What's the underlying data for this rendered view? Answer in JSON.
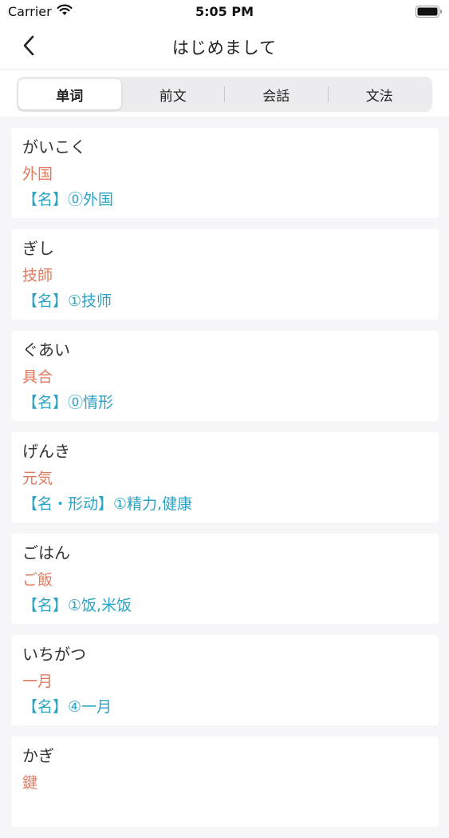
{
  "status_bar": {
    "carrier": "Carrier",
    "time": "5:05 PM"
  },
  "nav": {
    "title": "はじめまして"
  },
  "tabs": [
    {
      "label": "单词",
      "active": true
    },
    {
      "label": "前文",
      "active": false
    },
    {
      "label": "会話",
      "active": false
    },
    {
      "label": "文法",
      "active": false
    }
  ],
  "words": [
    {
      "kana": "がいこく",
      "kanji": "外国",
      "meaning": "【名】⓪外国"
    },
    {
      "kana": "ぎし",
      "kanji": "技師",
      "meaning": "【名】①技师"
    },
    {
      "kana": "ぐあい",
      "kanji": "具合",
      "meaning": "【名】⓪情形"
    },
    {
      "kana": "げんき",
      "kanji": "元気",
      "meaning": "【名・形动】①精力,健康"
    },
    {
      "kana": "ごはん",
      "kanji": "ご飯",
      "meaning": "【名】①饭,米饭"
    },
    {
      "kana": "いちがつ",
      "kanji": "一月",
      "meaning": "【名】④一月"
    },
    {
      "kana": "かぎ",
      "kanji": "鍵",
      "meaning": ""
    }
  ],
  "colors": {
    "kanji": "#e07a5f",
    "meaning": "#2ba3c4"
  }
}
